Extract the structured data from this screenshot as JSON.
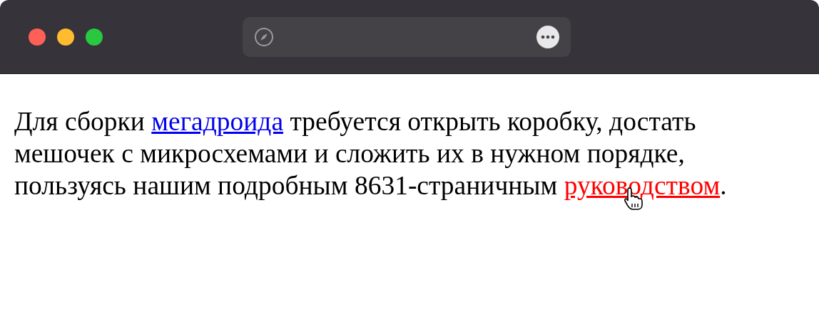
{
  "window": {
    "controls": [
      {
        "kind": "close"
      },
      {
        "kind": "minimize"
      },
      {
        "kind": "zoom"
      }
    ]
  },
  "paragraph": [
    {
      "kind": "text",
      "text": "Для сборки "
    },
    {
      "kind": "link",
      "text": "мегадроида",
      "hovered": false
    },
    {
      "kind": "text",
      "text": " требуется открыть коробку, достать мешочек с микросхемами и сложить их в нужном порядке, пользуясь нашим подробным 8631-страничным "
    },
    {
      "kind": "link",
      "text": "руководством",
      "hovered": true
    },
    {
      "kind": "text",
      "text": "."
    }
  ]
}
